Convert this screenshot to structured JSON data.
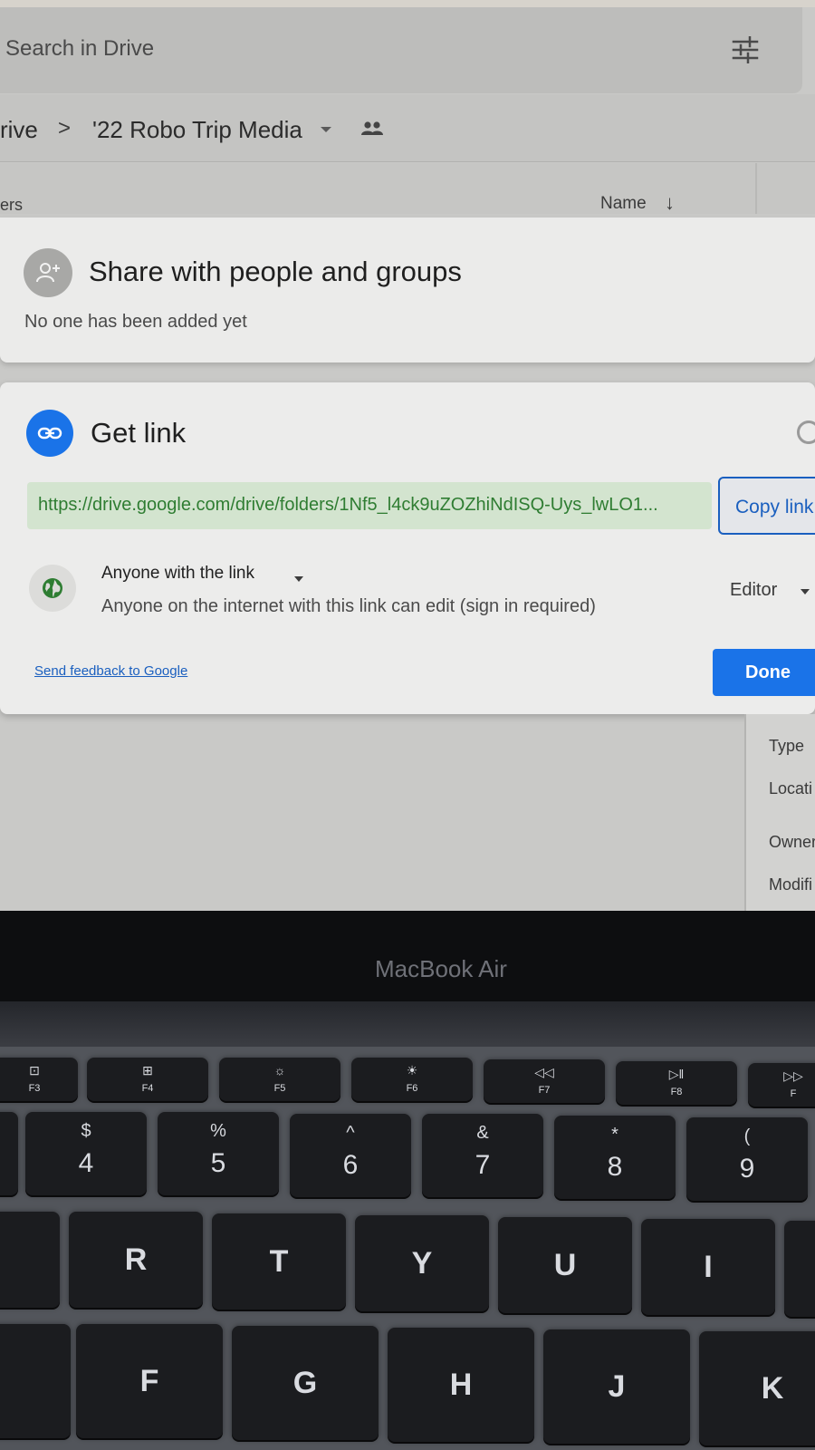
{
  "drive": {
    "search_placeholder": "Search in Drive",
    "breadcrumb": {
      "root": "rive",
      "separator": ">",
      "folder": "'22 Robo Trip Media"
    },
    "list_header": {
      "left_label": "ers",
      "sort_label": "Name",
      "sort_arrow": "↓"
    }
  },
  "share_dialog": {
    "people": {
      "title": "Share with people and groups",
      "subtitle": "No one has been added yet"
    },
    "link": {
      "title": "Get link",
      "url": "https://drive.google.com/drive/folders/1Nf5_l4ck9uZOZhiNdISQ-Uys_lwLO1...",
      "copy_label": "Copy link",
      "access_label": "Anyone with the link",
      "access_description": "Anyone on the internet with this link can edit (sign in required)",
      "role_label": "Editor",
      "feedback_label": "Send feedback to Google",
      "done_label": "Done"
    }
  },
  "details_panel": {
    "labels": [
      "Type",
      "Locati",
      "Owner",
      "Modifi"
    ]
  },
  "laptop": {
    "brand": "MacBook Air",
    "function_keys": [
      {
        "symbol": "⊡",
        "label": "F3"
      },
      {
        "symbol": "⊞",
        "label": "F4"
      },
      {
        "symbol": "☼",
        "label": "F5"
      },
      {
        "symbol": "☀",
        "label": "F6"
      },
      {
        "symbol": "◁◁",
        "label": "F7"
      },
      {
        "symbol": "▷ǁ",
        "label": "F8"
      },
      {
        "symbol": "▷▷",
        "label": "F"
      }
    ],
    "number_keys": [
      {
        "top": "$",
        "bottom": "4"
      },
      {
        "top": "%",
        "bottom": "5"
      },
      {
        "top": "^",
        "bottom": "6"
      },
      {
        "top": "&",
        "bottom": "7"
      },
      {
        "top": "*",
        "bottom": "8"
      },
      {
        "top": "(",
        "bottom": "9"
      }
    ],
    "letter_row_1": [
      "R",
      "T",
      "Y",
      "U",
      "I"
    ],
    "letter_row_2": [
      "F",
      "G",
      "H",
      "J",
      "K"
    ]
  },
  "colors": {
    "accent_blue": "#1a73e8",
    "link_green": "#2f7d32",
    "url_bg": "#d3e4cf"
  }
}
